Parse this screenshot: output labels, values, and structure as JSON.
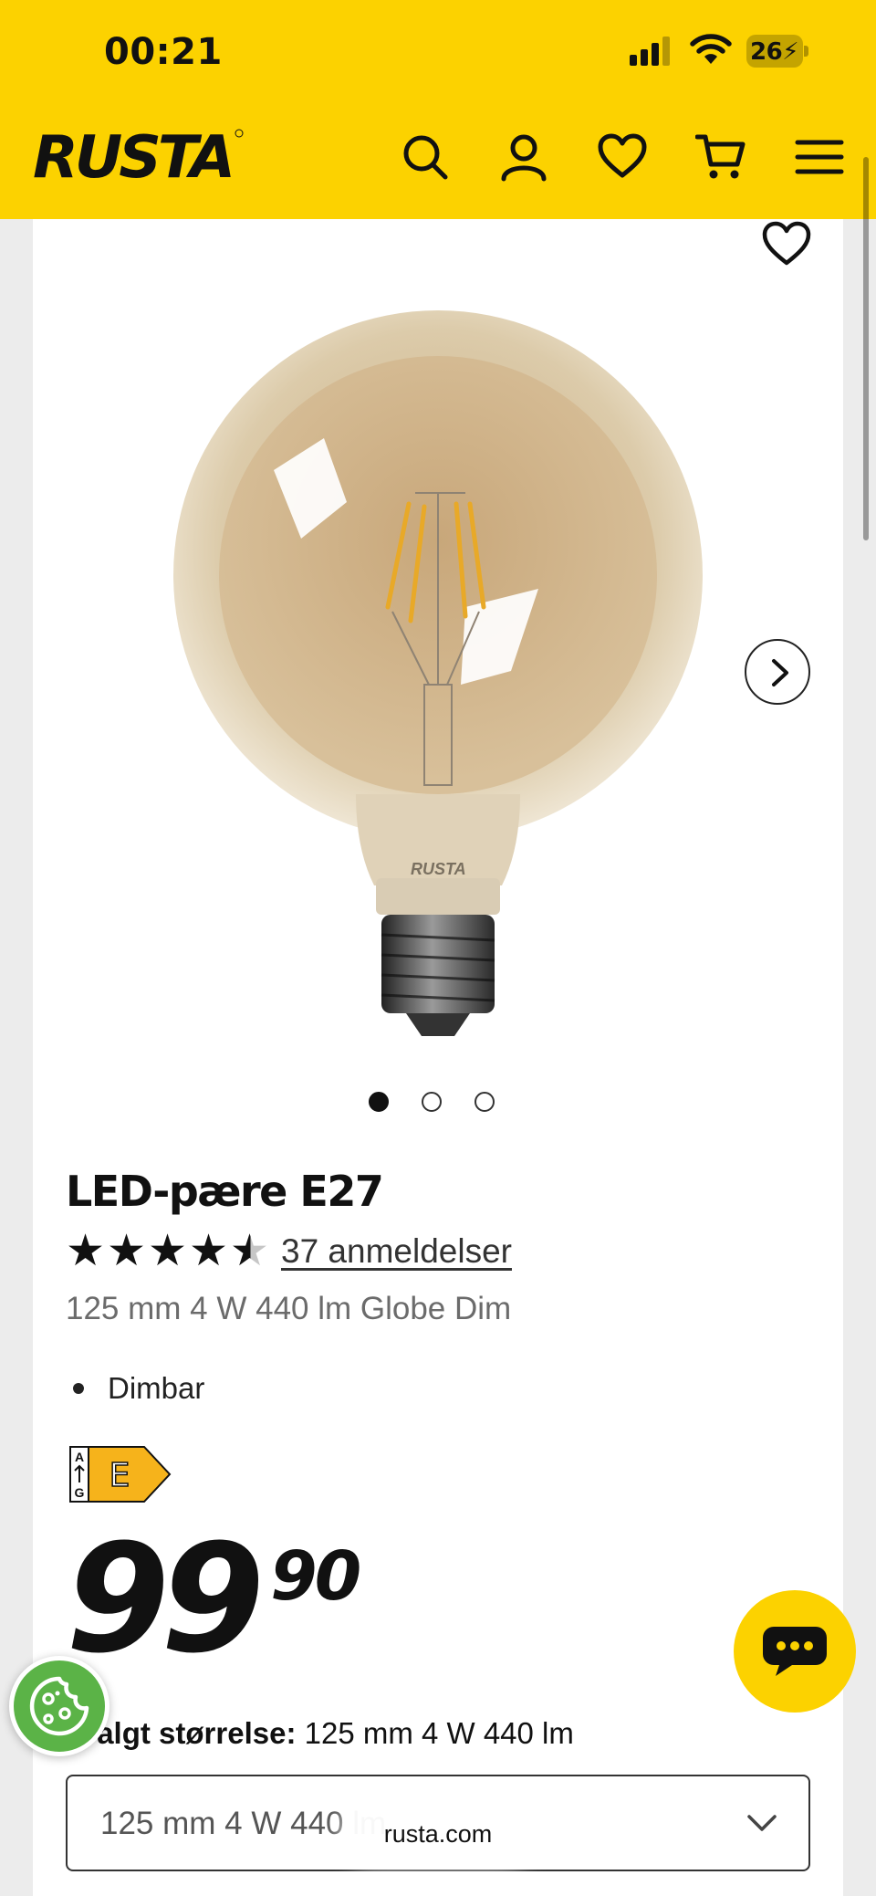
{
  "status_bar": {
    "time": "00:21",
    "battery": "26"
  },
  "header": {
    "brand": "RUSTA",
    "brand_color": "#fcd200",
    "icons": [
      "search-icon",
      "account-icon",
      "heart-icon",
      "cart-icon",
      "menu-icon"
    ]
  },
  "gallery": {
    "slide_count": 3,
    "active_slide": 1,
    "bulb_print": "RUSTA"
  },
  "product": {
    "title": "LED-pære E27",
    "rating": 4.5,
    "rating_max": 5,
    "reviews_label": "37 anmeldelser",
    "subtitle": "125 mm 4 W 440 lm Globe Dim",
    "features": [
      "Dimbar"
    ],
    "energy_class": "E",
    "energy_scale_top": "A",
    "energy_scale_bottom": "G",
    "price_main": "99",
    "price_cents": "90"
  },
  "size_selector": {
    "label": "Valgt størrelse:",
    "label_value": "125 mm 4 W 440 lm",
    "selected": "125 mm 4 W 440 lm"
  },
  "browser": {
    "url": "rusta.com"
  }
}
